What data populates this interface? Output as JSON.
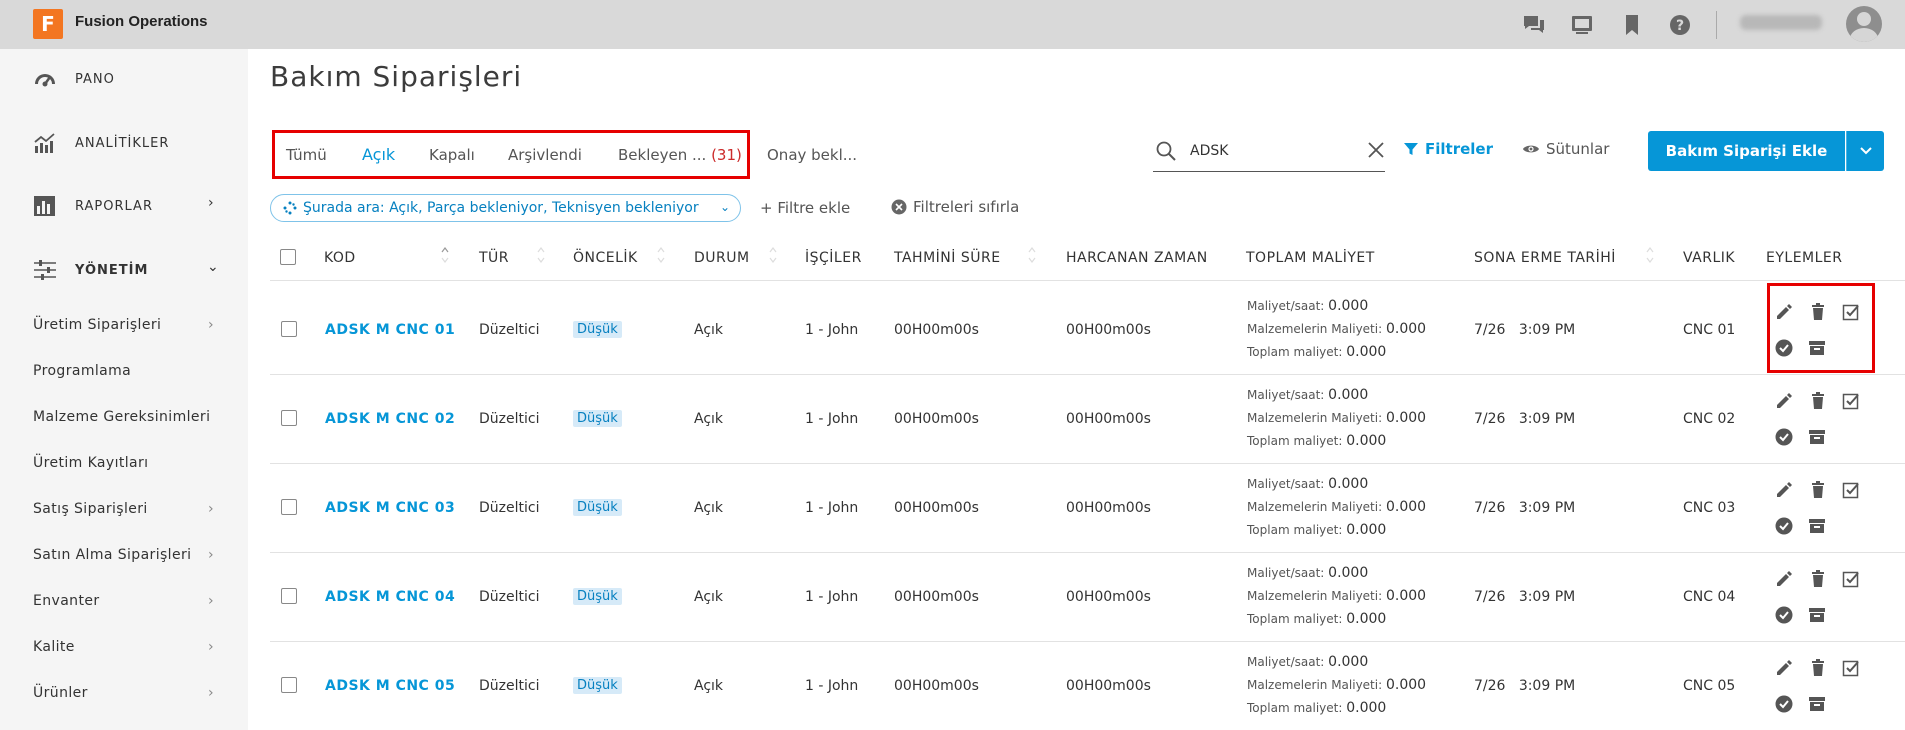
{
  "app": {
    "title": "Fusion Operations",
    "logo_letter": "F",
    "user_name": "Welcome User"
  },
  "sidebar": {
    "main": [
      {
        "label": "PANO",
        "icon": "gauge-icon"
      },
      {
        "label": "ANALİTİKLER",
        "icon": "analytics-icon"
      },
      {
        "label": "RAPORLAR",
        "icon": "reports-icon"
      },
      {
        "label": "YÖNETİM",
        "icon": "sliders-icon"
      }
    ],
    "sub": [
      "Üretim Siparişleri",
      "Programlama",
      "Malzeme Gereksinimleri",
      "Üretim Kayıtları",
      "Satış Siparişleri",
      "Satın Alma Siparişleri",
      "Envanter",
      "Kalite",
      "Ürünler"
    ]
  },
  "page": {
    "title": "Bakım Siparişleri"
  },
  "tabs": {
    "all": "Tümü",
    "open": "Açık",
    "closed": "Kapalı",
    "archived": "Arşivlendi",
    "pending": "Bekleyen ...",
    "pending_count": "(31)",
    "approval": "Onay bekl..."
  },
  "toolbar": {
    "search_value": "ADSK",
    "filters": "Filtreler",
    "columns": "Sütunlar",
    "add_button": "Bakım Siparişi Ekle"
  },
  "filter_bar": {
    "chip": "Şurada ara: Açık, Parça bekleniyor, Teknisyen bekleniyor",
    "add_filter": "+ Filtre ekle",
    "reset": "Filtreleri sıfırla"
  },
  "table": {
    "headers": {
      "code": "KOD",
      "type": "TÜR",
      "priority": "ÖNCELİK",
      "status": "DURUM",
      "workers": "İŞÇİLER",
      "estimated": "TAHMİNİ SÜRE",
      "spent": "HARCANAN ZAMAN",
      "total_cost": "TOPLAM MALİYET",
      "due_date": "SONA ERME TARİHİ",
      "asset": "VARLIK",
      "actions": "EYLEMLER"
    },
    "cost_labels": {
      "per_hour": "Maliyet/saat:",
      "materials": "Malzemelerin Maliyeti:",
      "total": "Toplam maliyet:"
    },
    "rows": [
      {
        "code": "ADSK M CNC 01",
        "type": "Düzeltici",
        "priority": "Düşük",
        "status": "Açık",
        "workers": "1 - John",
        "estimated": "00H00m00s",
        "spent": "00H00m00s",
        "per_hour": "0.000",
        "materials": "0.000",
        "total": "0.000",
        "due_date": "7/26",
        "due_time": "3:09 PM",
        "asset": "CNC 01"
      },
      {
        "code": "ADSK M CNC 02",
        "type": "Düzeltici",
        "priority": "Düşük",
        "status": "Açık",
        "workers": "1 - John",
        "estimated": "00H00m00s",
        "spent": "00H00m00s",
        "per_hour": "0.000",
        "materials": "0.000",
        "total": "0.000",
        "due_date": "7/26",
        "due_time": "3:09 PM",
        "asset": "CNC 02"
      },
      {
        "code": "ADSK M CNC 03",
        "type": "Düzeltici",
        "priority": "Düşük",
        "status": "Açık",
        "workers": "1 - John",
        "estimated": "00H00m00s",
        "spent": "00H00m00s",
        "per_hour": "0.000",
        "materials": "0.000",
        "total": "0.000",
        "due_date": "7/26",
        "due_time": "3:09 PM",
        "asset": "CNC 03"
      },
      {
        "code": "ADSK M CNC 04",
        "type": "Düzeltici",
        "priority": "Düşük",
        "status": "Açık",
        "workers": "1 - John",
        "estimated": "00H00m00s",
        "spent": "00H00m00s",
        "per_hour": "0.000",
        "materials": "0.000",
        "total": "0.000",
        "due_date": "7/26",
        "due_time": "3:09 PM",
        "asset": "CNC 04"
      },
      {
        "code": "ADSK M CNC 05",
        "type": "Düzeltici",
        "priority": "Düşük",
        "status": "Açık",
        "workers": "1 - John",
        "estimated": "00H00m00s",
        "spent": "00H00m00s",
        "per_hour": "0.000",
        "materials": "0.000",
        "total": "0.000",
        "due_date": "7/26",
        "due_time": "3:09 PM",
        "asset": "CNC 05"
      }
    ]
  },
  "colors": {
    "accent": "#0696d7",
    "highlight": "#e60000",
    "sidebar_bg": "#f5f5f5",
    "topbar_bg": "#d9d9d9"
  }
}
